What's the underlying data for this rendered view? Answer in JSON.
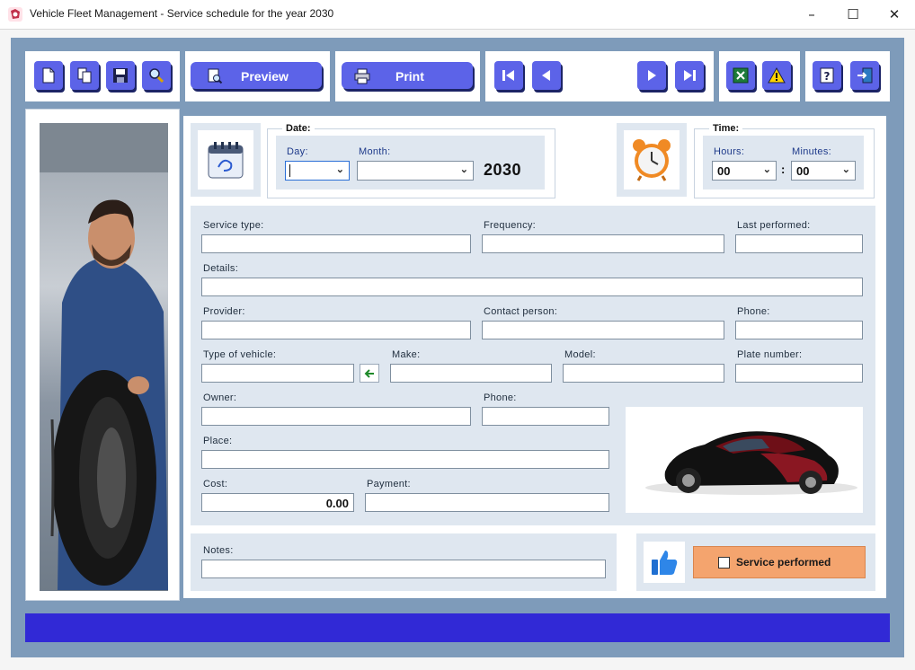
{
  "window": {
    "title": "Vehicle Fleet Management - Service schedule for the year 2030",
    "controls": [
      "–",
      "☐",
      "✕"
    ]
  },
  "toolbar": {
    "preview_label": "Preview",
    "print_label": "Print",
    "icons": [
      "new-icon",
      "copy-icon",
      "save-icon",
      "search-icon",
      "first-icon",
      "prev-icon",
      "next-icon",
      "last-icon",
      "excel-icon",
      "warning-icon",
      "help-icon",
      "exit-icon"
    ]
  },
  "date": {
    "group_label": "Date:",
    "day_label": "Day:",
    "month_label": "Month:",
    "day_value": "",
    "month_value": "",
    "year": "2030"
  },
  "time": {
    "group_label": "Time:",
    "hours_label": "Hours:",
    "minutes_label": "Minutes:",
    "hours_value": "00",
    "minutes_value": "00",
    "separator": ":"
  },
  "form": {
    "service_type_label": "Service type:",
    "frequency_label": "Frequency:",
    "last_performed_label": "Last performed:",
    "details_label": "Details:",
    "provider_label": "Provider:",
    "contact_person_label": "Contact person:",
    "phone_label": "Phone:",
    "type_of_vehicle_label": "Type of vehicle:",
    "make_label": "Make:",
    "model_label": "Model:",
    "plate_number_label": "Plate number:",
    "owner_label": "Owner:",
    "owner_phone_label": "Phone:",
    "place_label": "Place:",
    "cost_label": "Cost:",
    "cost_value": "0.00",
    "payment_label": "Payment:",
    "notes_label": "Notes:"
  },
  "service_performed": {
    "label": "Service performed",
    "checked": false
  },
  "colors": {
    "accent_button": "#5c63e8",
    "status_bar": "#3129d6",
    "service_button": "#f4a46e"
  }
}
